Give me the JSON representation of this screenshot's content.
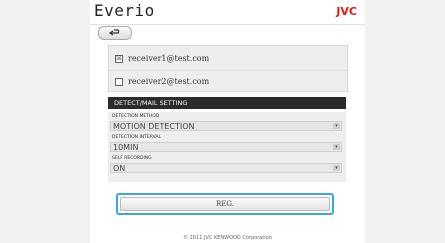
{
  "header": {
    "brand": "Everio",
    "logo": "JVC",
    "back_icon": "back-arrow-icon"
  },
  "receivers": [
    {
      "address": "receiver1@test.com",
      "checked": true
    },
    {
      "address": "receiver2@test.com",
      "checked": false
    }
  ],
  "settings": {
    "section_title": "DETECT/MAIL SETTING",
    "detection_method": {
      "label": "DETECTION METHOD",
      "value": "MOTION DETECTION"
    },
    "detection_interval": {
      "label": "DETECTION INTERVAL",
      "value": "10MIN"
    },
    "self_recording": {
      "label": "SELF RECORDING",
      "value": "ON"
    }
  },
  "actions": {
    "register_label": "REG."
  },
  "footer": {
    "copyright": "© 2011 JVC KENWOOD Corporation"
  },
  "colors": {
    "logo": "#e11a1a",
    "focus": "#3aa7dd",
    "section_bar": "#2b2b2b"
  }
}
